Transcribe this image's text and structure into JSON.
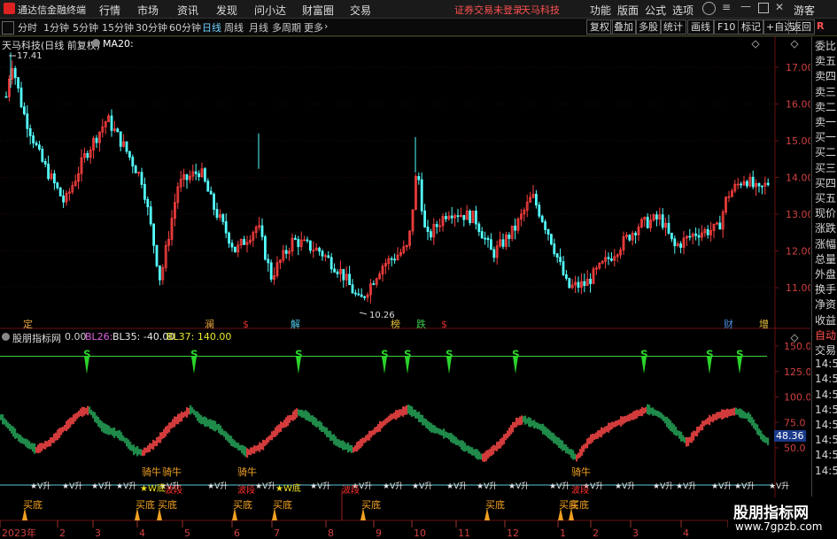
{
  "app": {
    "name": "通达信金融终端",
    "menu": [
      "行情",
      "市场",
      "资讯",
      "发现",
      "问小达",
      "财富圈",
      "交易"
    ],
    "notice": "证券交易未登录",
    "stock_banner": "天马科技",
    "right_menu": [
      "功能",
      "版面",
      "公式",
      "选项"
    ],
    "guest": "游客"
  },
  "toolbar": {
    "periods": [
      "分时",
      "1分钟",
      "5分钟",
      "15分钟",
      "30分钟",
      "60分钟",
      "日线",
      "周线",
      "月线",
      "多周期",
      "更多"
    ],
    "active_period": "日线",
    "buttons": [
      "复权",
      "叠加",
      "多股",
      "统计",
      "画线",
      "F10",
      "标记",
      "+自选",
      "返回"
    ]
  },
  "main_chart": {
    "title": "天马科技(日线 前复权)",
    "ma_label": "MA20:",
    "high_label": "17.41",
    "low_label": "10.26",
    "y_ticks": [
      "17.00",
      "16.00",
      "15.00",
      "14.00",
      "13.00",
      "12.00",
      "11.00"
    ],
    "event_marks": [
      {
        "text": "定",
        "color": "#e8a33a"
      },
      {
        "text": "澜",
        "color": "#e8a33a"
      },
      {
        "text": "$",
        "color": "#e03030"
      },
      {
        "text": "解",
        "color": "#4ec9e8"
      },
      {
        "text": "榜",
        "color": "#e8c23a"
      },
      {
        "text": "跌",
        "color": "#3ac94e"
      },
      {
        "text": "$",
        "color": "#e03030"
      },
      {
        "text": "财",
        "color": "#4e8fe8"
      },
      {
        "text": "增",
        "color": "#e8c23a"
      }
    ]
  },
  "indicator": {
    "name": "股朋指标网",
    "params": [
      {
        "text": "0.00",
        "color": "#d0d0d0"
      },
      {
        "text": "BL26:",
        "color": "#e060e0"
      },
      {
        "text": "BL35: -40.00",
        "color": "#e8e8e8"
      },
      {
        "text": "BL37: 140.00",
        "color": "#e8e830"
      }
    ],
    "y_ticks": [
      "150.0",
      "125.0",
      "100.0",
      "75.0",
      "50.0"
    ],
    "current_value": "48.36",
    "s_signal": "S",
    "vsheng": "V升",
    "mainniu": "骑牛",
    "bodiv": "W底",
    "boduan": "波段",
    "buy_bottom": "买底"
  },
  "x_axis": {
    "labels": [
      "2023年",
      "2",
      "3",
      "4",
      "5",
      "6",
      "7",
      "8",
      "9",
      "10",
      "11",
      "12",
      "1",
      "2",
      "3",
      "4",
      "5"
    ]
  },
  "right_panel": {
    "labels": [
      "委比",
      "卖五",
      "卖四",
      "卖三",
      "卖二",
      "卖一",
      "买一",
      "买二",
      "买三",
      "买四",
      "买五",
      "现价",
      "涨跌",
      "涨幅",
      "总量",
      "外盘",
      "换手",
      "净资",
      "收益",
      "自动",
      "交易",
      "14:56",
      "14:56",
      "14:56",
      "14:56",
      "14:56",
      "14:56",
      "14:56",
      "14:56"
    ]
  },
  "watermark": {
    "title": "股朋指标网",
    "url": "www.7gpzb.com"
  },
  "colors": {
    "up": "#ff4040",
    "down": "#54ffff",
    "indicator_up": "#d23b3b",
    "indicator_down": "#1f8a4a",
    "grid": "#6a1010"
  }
}
